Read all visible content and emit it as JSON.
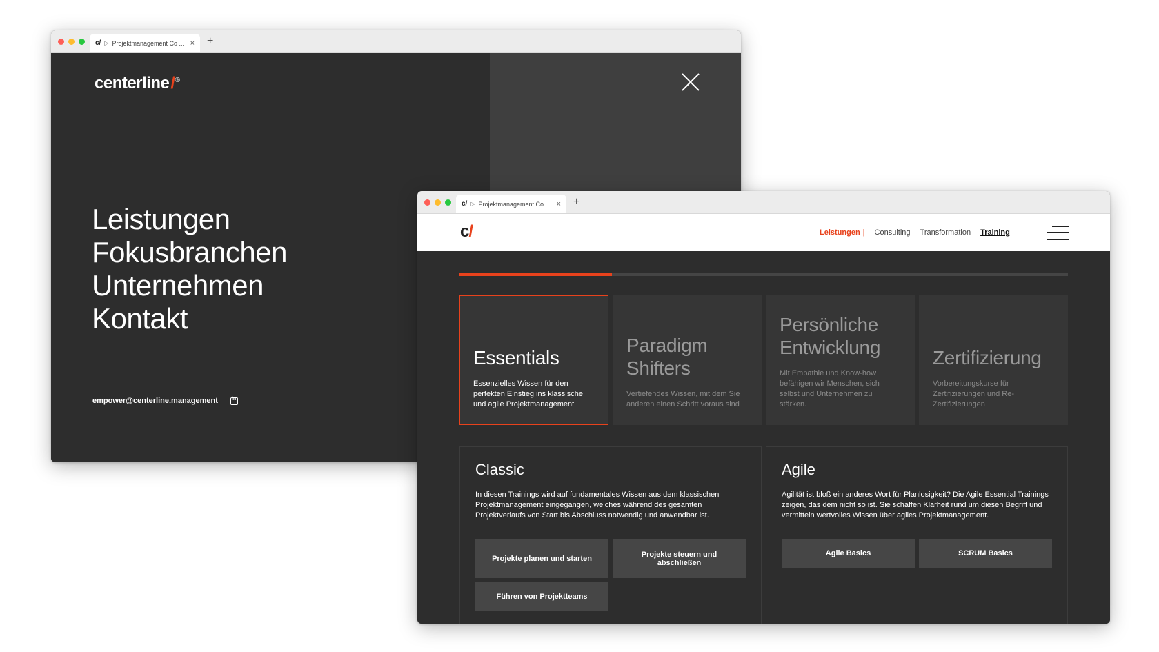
{
  "back": {
    "tab": {
      "favicon": "c/",
      "title": "Projektmanagement Co ...",
      "close": "×",
      "new_tab": "+"
    },
    "brand": {
      "name": "centerline",
      "slash": "/",
      "mark": "®"
    },
    "menu": [
      "Leistungen",
      "Fokusbranchen",
      "Unternehmen",
      "Kontakt"
    ],
    "email": "empower@centerline.management"
  },
  "front": {
    "tab": {
      "favicon": "c/",
      "title": "Projektmanagement Co ...",
      "close": "×",
      "new_tab": "+"
    },
    "logo": {
      "c": "c",
      "slash": "/"
    },
    "nav": {
      "leistungen": "Leistungen",
      "pipe": "|",
      "consulting": "Consulting",
      "transformation": "Transformation",
      "training": "Training"
    },
    "progress": 0.25,
    "categories": [
      {
        "title": "Essentials",
        "desc": "Essenzielles Wissen für den perfekten Einstieg ins klassische und agile Projektmanagement"
      },
      {
        "title": "Paradigm Shifters",
        "desc": "Vertiefendes Wissen, mit dem Sie anderen einen Schritt voraus sind"
      },
      {
        "title": "Persönliche Entwicklung",
        "desc": "Mit Empathie und Know-how befähigen wir Menschen, sich selbst und Unternehmen zu stärken."
      },
      {
        "title": "Zertifizierung",
        "desc": "Vorbereitungskurse für Zertifizierungen und Re-Zertifizierungen"
      }
    ],
    "classic": {
      "title": "Classic",
      "desc": "In diesen Trainings wird auf fundamentales Wissen aus dem klassischen Projektmanagement eingegangen, welches während des gesamten Projektverlaufs von Start bis Abschluss notwendig und anwendbar ist.",
      "buttons": [
        "Projekte planen und starten",
        "Projekte steuern und abschließen",
        "Führen von Projektteams"
      ]
    },
    "agile": {
      "title": "Agile",
      "desc": "Agilität ist bloß ein anderes Wort für Planlosigkeit? Die Agile Essential Trainings zeigen, das dem nicht so ist. Sie schaffen Klarheit rund um diesen Begriff und vermitteln wertvolles Wissen über agiles Projektmanagement.",
      "buttons": [
        "Agile Basics",
        "SCRUM Basics"
      ]
    }
  },
  "colors": {
    "accent": "#e8421c",
    "dark": "#2d2d2d",
    "panel": "#363636"
  }
}
